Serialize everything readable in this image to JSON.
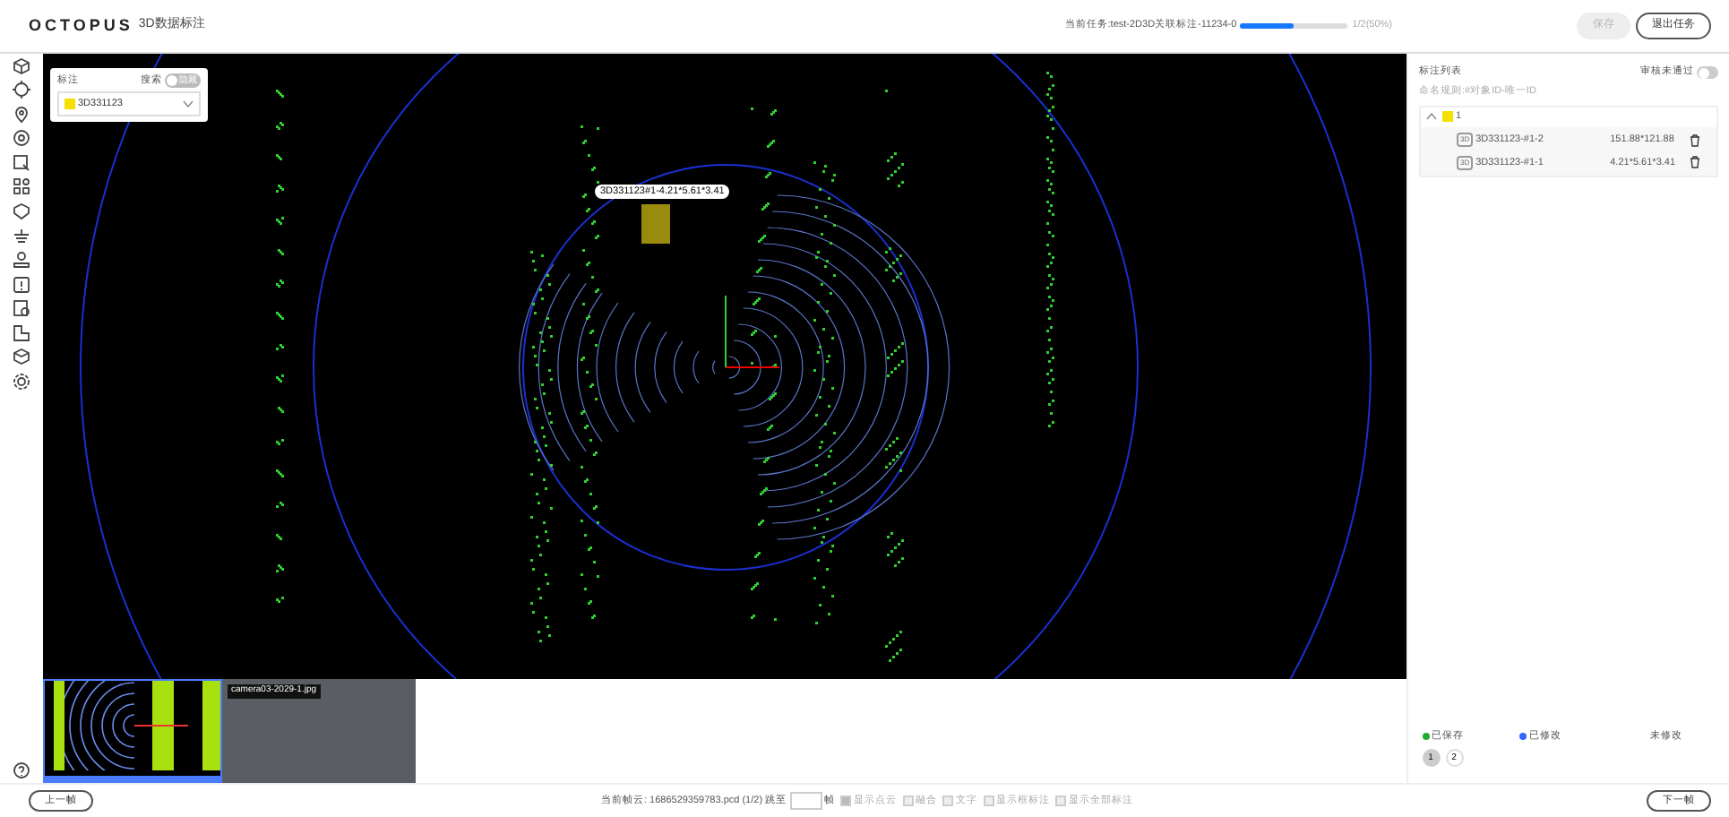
{
  "header": {
    "logo": "OCTOPUS",
    "app_title": "3D数据标注",
    "task": "当前任务:test-2D3D关联标注-11234-0",
    "progress": {
      "level": 0.5,
      "reading": "1/2(50%)"
    },
    "buttons": [
      {
        "label": "保存",
        "disabled": true
      },
      {
        "label": "退出任务",
        "disabled": false
      }
    ]
  },
  "label_panel": {
    "title": "标注",
    "switch_label": "搜索",
    "switch_text": "隐藏",
    "switch_on": false,
    "selected_label": "3D331123",
    "color": "#f5e000"
  },
  "canvas": {
    "box_label": "3D331123#1-4.21*5.61*3.41"
  },
  "thumbnails": [
    {
      "kind": "pointcloud",
      "selected": true
    },
    {
      "kind": "camera",
      "caption": "camera03-2029-1.jpg",
      "selected": false
    }
  ],
  "annotation_list": {
    "title": "标注列表",
    "review_label": "审核未通过",
    "review_on": false,
    "naming_rule": "命名规则:#对象ID-唯一ID",
    "groups": [
      {
        "name": "1",
        "color": "#f5e000",
        "expanded": true,
        "items": [
          {
            "tag": "3D",
            "name": "3D331123-#1-2",
            "size": "151.88*121.88"
          },
          {
            "tag": "3D",
            "name": "3D331123-#1-1",
            "size": "4.21*5.61*3.41"
          }
        ]
      }
    ]
  },
  "legend": [
    {
      "label": "已保存",
      "color": "#22aa33"
    },
    {
      "label": "已修改",
      "color": "#3366ff"
    },
    {
      "label": "未修改"
    }
  ],
  "pages": [
    {
      "label": "1",
      "selected": true
    },
    {
      "label": "2",
      "selected": false
    }
  ],
  "footer": {
    "prev": "上一帧",
    "frame_label": "当前帧云: 1686529359783.pcd (1/2)",
    "jump_label": "跳至",
    "jump_unit": "帧",
    "options": [
      {
        "label": "显示点云",
        "checked": true
      },
      {
        "label": "融合",
        "checked": false
      },
      {
        "label": "文字",
        "checked": false
      },
      {
        "label": "显示框标注",
        "checked": false
      },
      {
        "label": "显示全部标注",
        "checked": false
      }
    ],
    "next": "下一帧"
  }
}
